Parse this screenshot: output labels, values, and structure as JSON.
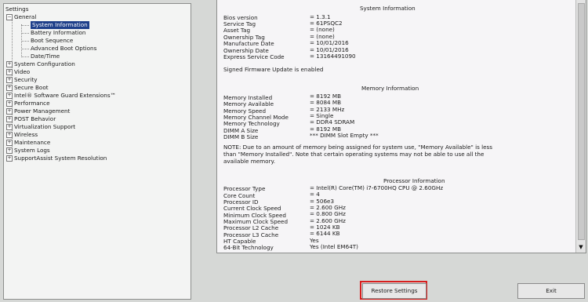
{
  "sidebar": {
    "root_label": "Settings",
    "items": [
      {
        "label": "General",
        "expanded": true
      },
      {
        "label": "System Information",
        "selected": true
      },
      {
        "label": "Battery Information"
      },
      {
        "label": "Boot Sequence"
      },
      {
        "label": "Advanced Boot Options"
      },
      {
        "label": "Date/Time"
      },
      {
        "label": "System Configuration"
      },
      {
        "label": "Video"
      },
      {
        "label": "Security"
      },
      {
        "label": "Secure Boot"
      },
      {
        "label": "Intel® Software Guard Extensions™"
      },
      {
        "label": "Performance"
      },
      {
        "label": "Power Management"
      },
      {
        "label": "POST Behavior"
      },
      {
        "label": "Virtualization Support"
      },
      {
        "label": "Wireless"
      },
      {
        "label": "Maintenance"
      },
      {
        "label": "System Logs"
      },
      {
        "label": "SupportAssist System Resolution"
      }
    ]
  },
  "system_info": {
    "title": "System Information",
    "rows": [
      {
        "label": "Bios version",
        "value": "= 1.3.1"
      },
      {
        "label": "Service Tag",
        "value": "= 61PSQC2"
      },
      {
        "label": "Asset Tag",
        "value": "= (none)"
      },
      {
        "label": "Ownership Tag",
        "value": "= (none)"
      },
      {
        "label": "Manufacture Date",
        "value": "= 10/01/2016"
      },
      {
        "label": "Ownership Date",
        "value": "= 10/01/2016"
      },
      {
        "label": "Express Service Code",
        "value": "= 13164491090"
      }
    ],
    "firmware_note": "Signed Firmware Update is enabled"
  },
  "memory_info": {
    "title": "Memory Information",
    "rows": [
      {
        "label": "Memory Installed",
        "value": "= 8192 MB"
      },
      {
        "label": "Memory Available",
        "value": "= 8084 MB"
      },
      {
        "label": "Memory Speed",
        "value": "= 2133 MHz"
      },
      {
        "label": "Memory Channel Mode",
        "value": "= Single"
      },
      {
        "label": "Memory Technology",
        "value": "= DDR4 SDRAM"
      },
      {
        "label": "DIMM A Size",
        "value": "= 8192 MB"
      },
      {
        "label": "DIMM B Size",
        "value": "*** DIMM Slot Empty ***"
      }
    ],
    "note": "NOTE: Due to an amount of memory being assigned for system use, \"Memory Available\" is less than \"Memory Installed\". Note that certain operating systems may not be able to use all the available memory."
  },
  "processor_info": {
    "title": "Processor Information",
    "rows": [
      {
        "label": "Processor Type",
        "value": "= Intel(R) Core(TM) i7-6700HQ CPU @ 2.60GHz"
      },
      {
        "label": "Core Count",
        "value": "= 4"
      },
      {
        "label": "Processor ID",
        "value": "= 506e3"
      },
      {
        "label": "Current Clock Speed",
        "value": "= 2.600 GHz"
      },
      {
        "label": "Minimum Clock Speed",
        "value": "= 0.800 GHz"
      },
      {
        "label": "Maximum Clock Speed",
        "value": "= 2.600 GHz"
      },
      {
        "label": "Processor L2 Cache",
        "value": "= 1024 KB"
      },
      {
        "label": "Processor L3 Cache",
        "value": "= 6144 KB"
      },
      {
        "label": "HT Capable",
        "value": "Yes"
      },
      {
        "label": "64-Bit Technology",
        "value": "Yes (Intel EM64T)"
      }
    ]
  },
  "buttons": {
    "restore_label": "Restore Settings",
    "exit_label": "Exit"
  },
  "colors": {
    "selection": "#1e3f8a",
    "highlight": "#d81e1e"
  }
}
